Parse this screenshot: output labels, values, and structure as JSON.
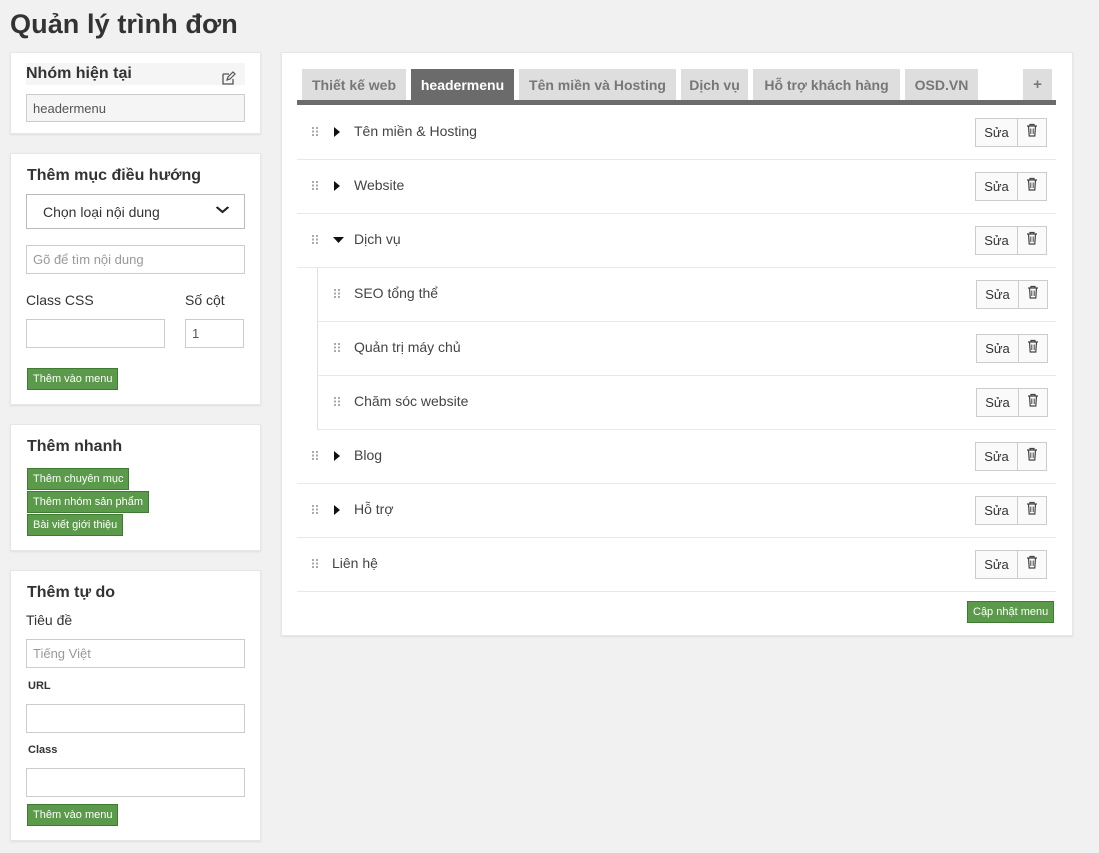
{
  "page": {
    "title": "Quản lý trình đơn"
  },
  "current_group": {
    "title": "Nhóm hiện tại",
    "value": "headermenu",
    "edit_icon": "edit-icon"
  },
  "add_nav": {
    "title": "Thêm mục điều hướng",
    "select_value": "Chọn loại nội dung",
    "search_placeholder": "Gõ để tìm nội dung",
    "class_label": "Class CSS",
    "columns_label": "Số cột",
    "columns_value": "1",
    "add_button": "Thêm vào menu"
  },
  "quick_add": {
    "title": "Thêm nhanh",
    "buttons": [
      "Thêm chuyên mục",
      "Thêm nhóm sản phẩm",
      "Bài viết giới thiệu"
    ]
  },
  "free_add": {
    "title": "Thêm tự do",
    "title_label": "Tiêu đề",
    "title_placeholder": "Tiếng Việt",
    "url_label": "URL",
    "class_label": "Class",
    "add_button": "Thêm vào menu"
  },
  "tabs": [
    {
      "label": "Thiết kế web",
      "active": false
    },
    {
      "label": "headermenu",
      "active": true
    },
    {
      "label": "Tên miền và Hosting",
      "active": false
    },
    {
      "label": "Dịch vụ",
      "active": false
    },
    {
      "label": "Hỗ trợ khách hàng",
      "active": false
    },
    {
      "label": "OSD.VN",
      "active": false
    }
  ],
  "add_tab_label": "+",
  "menu_items": [
    {
      "label": "Tên miền & Hosting",
      "level": 0,
      "caret": "right"
    },
    {
      "label": "Website",
      "level": 0,
      "caret": "right"
    },
    {
      "label": "Dịch vụ",
      "level": 0,
      "caret": "down"
    },
    {
      "label": "SEO tổng thể",
      "level": 1,
      "caret": "none"
    },
    {
      "label": "Quản trị máy chủ",
      "level": 1,
      "caret": "none"
    },
    {
      "label": "Chăm sóc website",
      "level": 1,
      "caret": "none"
    },
    {
      "label": "Blog",
      "level": 0,
      "caret": "right"
    },
    {
      "label": "Hỗ trợ",
      "level": 0,
      "caret": "right"
    },
    {
      "label": "Liên hệ",
      "level": 0,
      "caret": "none"
    }
  ],
  "row_actions": {
    "edit_label": "Sửa",
    "delete_icon": "trash-icon"
  },
  "update_button": "Cập nhật menu",
  "colors": {
    "accent_green": "#5a9a4a",
    "tab_active": "#6b6b6b",
    "tab_inactive": "#dedede"
  }
}
